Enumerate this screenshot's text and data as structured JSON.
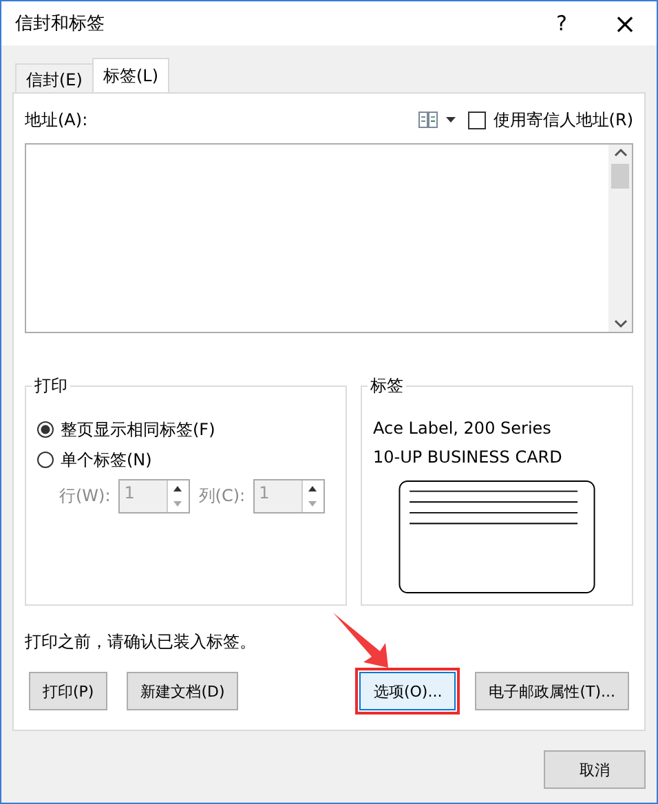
{
  "window": {
    "title": "信封和标签",
    "help": "?",
    "close": "×"
  },
  "tabs": [
    {
      "label": "信封(E)",
      "selected": false
    },
    {
      "label": "标签(L)",
      "selected": true
    }
  ],
  "address": {
    "label": "地址(A):",
    "use_return_address": {
      "label": "使用寄信人地址(R)",
      "checked": false
    }
  },
  "print_group": {
    "title": "打印",
    "options": [
      {
        "label": "整页显示相同标签(F)",
        "selected": true
      },
      {
        "label": "单个标签(N)",
        "selected": false
      }
    ],
    "spinners": [
      {
        "label": "行(W):",
        "value": "1",
        "disabled": true
      },
      {
        "label": "列(C):",
        "value": "1",
        "disabled": true
      }
    ]
  },
  "label_group": {
    "title": "标签",
    "lines": [
      "Ace Label, 200 Series",
      "10-UP BUSINESS CARD"
    ]
  },
  "note": "打印之前，请确认已装入标签。",
  "buttons": [
    {
      "label": "打印(P)",
      "highlighted": false
    },
    {
      "label": "新建文档(D)",
      "highlighted": false
    },
    {
      "label": "选项(O)...",
      "highlighted": true
    },
    {
      "label": "电子邮政属性(T)...",
      "highlighted": false
    }
  ],
  "cancel": "取消"
}
